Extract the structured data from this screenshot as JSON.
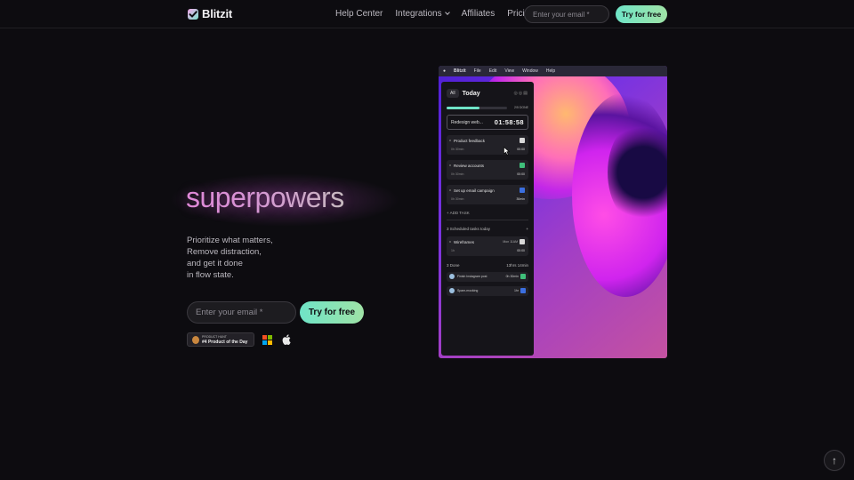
{
  "nav": {
    "brand": "Blitzit",
    "links": {
      "help": "Help Center",
      "integrations": "Integrations",
      "affiliates": "Affiliates",
      "pricing": "Pricing"
    },
    "email_placeholder": "Enter your email *",
    "cta": "Try for free"
  },
  "hero": {
    "headline": "superpowers",
    "subtitle": [
      "Prioritize what matters,",
      "Remove distraction,",
      "and get it done",
      "in flow state."
    ],
    "email_placeholder": "Enter your email *",
    "cta": "Try for free",
    "badge": {
      "small": "PRODUCT HUNT",
      "main": "#4 Product of the Day"
    },
    "accent_colors": [
      "#6fe4c7",
      "#9fe3a6"
    ]
  },
  "app": {
    "menubar": {
      "brand": "Blitzit",
      "items": [
        "File",
        "Edit",
        "View",
        "Window",
        "Help"
      ]
    },
    "filter": "All",
    "title": "Today",
    "progress": {
      "fraction": 0.55,
      "label": "2/5 DONE"
    },
    "timer": {
      "task": "Redesign web...",
      "time": "01:58:58"
    },
    "tasks": [
      {
        "name": "Product feedback",
        "estimate": "0h 30min",
        "elapsed": "00:00",
        "check_color": "#d8d8d8"
      },
      {
        "name": "Review accounts",
        "estimate": "0h 30min",
        "elapsed": "00:00",
        "check_color": "#3fbf7a"
      },
      {
        "name": "Set up email campaign",
        "estimate": "0h 30min",
        "elapsed": "30min",
        "check_color": "#3b6fe0"
      }
    ],
    "add_task": "+ ADD TASK",
    "scheduled": {
      "label": "3 Scheduled tasks today",
      "action": "+"
    },
    "scheduled_task": {
      "name": "Wireframes",
      "when": "Mon 11AM",
      "estimate": "1h",
      "elapsed": "00:00"
    },
    "done": {
      "label": "3 Done",
      "total": "13hrs 14min"
    },
    "done_tasks": [
      {
        "name": "Finish Instagram post",
        "time": "0h 30min",
        "check_color": "#3fbf7a"
      },
      {
        "name": "Spam-mocking",
        "time": "1hr",
        "check_color": "#3b6fe0"
      }
    ]
  },
  "scroll_top": "↑"
}
